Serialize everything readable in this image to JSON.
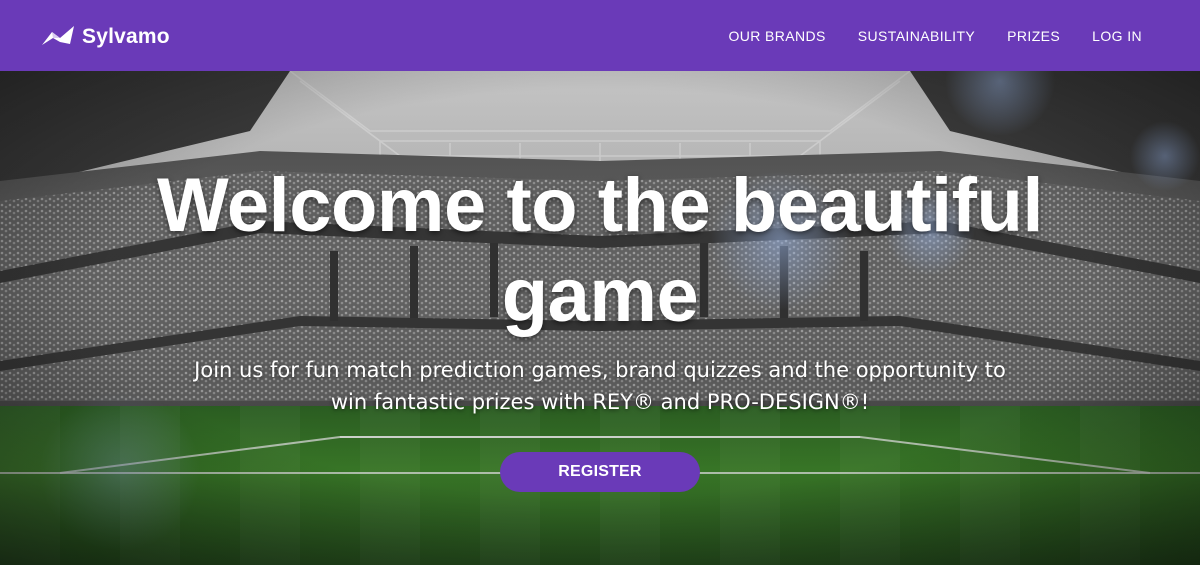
{
  "header": {
    "brand_name": "Sylvamo",
    "brand_icon": "sylvamo-logo-icon",
    "nav": [
      {
        "label": "OUR BRANDS"
      },
      {
        "label": "SUSTAINABILITY"
      },
      {
        "label": "PRIZES"
      },
      {
        "label": "LOG IN"
      }
    ]
  },
  "hero": {
    "title": "Welcome to the beautiful game",
    "subtitle": "Join us for fun match prediction games, brand quizzes and the opportunity to win fantastic prizes with REY® and PRO-DESIGN®!",
    "cta_label": "REGISTER",
    "background": "stadium-image"
  },
  "colors": {
    "brand_purple": "#6a3ab8",
    "text": "#ffffff",
    "pitch_green": "#3f8a2a"
  }
}
